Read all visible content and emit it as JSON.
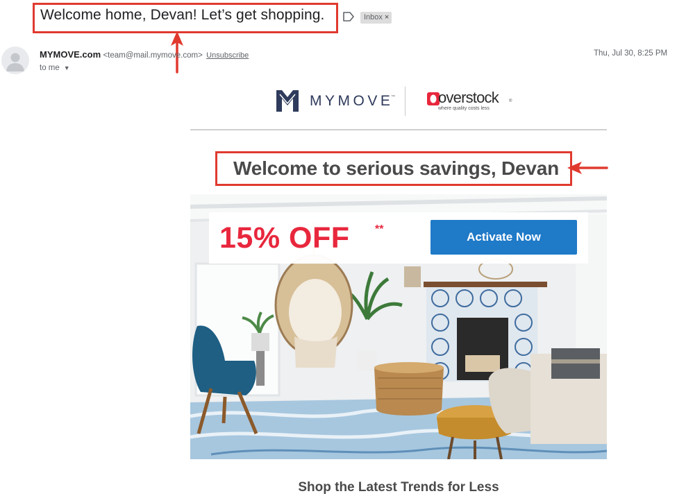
{
  "email": {
    "subject": "Welcome home, Devan! Let’s get shopping.",
    "label_chip": "Inbox",
    "label_chip_close": "×",
    "sender_name": "MYMOVE.com",
    "sender_email": "<team@mail.mymove.com>",
    "unsubscribe": "Unsubscribe",
    "recipient": "to me",
    "date": "Thu, Jul 30, 8:25 PM"
  },
  "body": {
    "brand_left": "MYMOVE",
    "brand_left_tm": "™",
    "brand_right": "overstock",
    "brand_right_tm": "®",
    "brand_right_tagline": "where quality costs less",
    "headline": "Welcome to serious savings, Devan",
    "promo": "15% OFF",
    "promo_marker": "**",
    "cta_label": "Activate Now",
    "subheading": "Shop the Latest Trends for Less"
  },
  "colors": {
    "annotation_red": "#e03a2f",
    "promo_red": "#e8273d",
    "cta_blue": "#1f7ac8",
    "mymove_navy": "#2f3b5c"
  },
  "icons": [
    "label-arrow-icon",
    "default-avatar-icon",
    "caret-down-icon",
    "mymove-logo-icon",
    "overstock-logo-icon",
    "annotation-arrow-icon"
  ]
}
